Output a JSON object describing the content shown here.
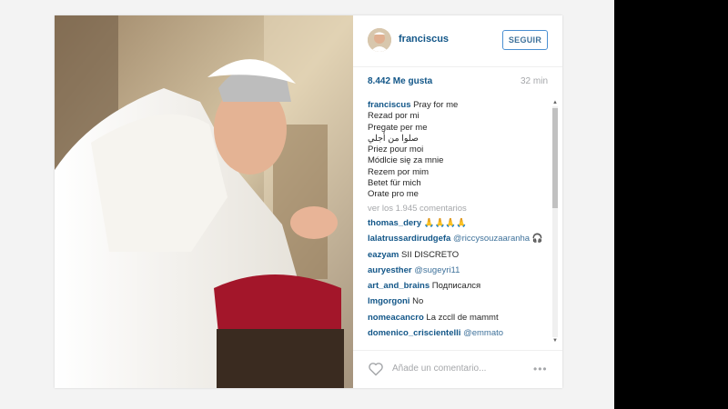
{
  "post": {
    "username": "franciscus",
    "follow_label": "SEGUIR",
    "likes": "8.442 Me gusta",
    "time": "32 min",
    "caption_user": "franciscus",
    "caption_lines": [
      "Pray for me",
      "Rezad por mi",
      "Pregate per me",
      "صلوا من أجلي",
      "Priez pour moi",
      "Módlcie się za mnie",
      "Rezem por mim",
      "Betet für mich",
      "Orate pro me"
    ],
    "view_all": "ver los 1.945 comentarios",
    "comments": [
      {
        "user": "thomas_dery",
        "text": " 🙏🙏🙏🙏"
      },
      {
        "user": "lalatrussardirudgefa",
        "mention": "@riccysouzaaranha",
        "text": " 🎧"
      },
      {
        "user": "eazyam",
        "text": "SII DISCRETO"
      },
      {
        "user": "auryesther",
        "mention": "@sugeyri11",
        "text": ""
      },
      {
        "user": "art_and_brains",
        "text": "Подписался"
      },
      {
        "user": "lmgorgoni",
        "text": "No"
      },
      {
        "user": "nomeacancro",
        "text": "La zccll de mammt"
      },
      {
        "user": "domenico_criscientelli",
        "text": "@emmato"
      }
    ],
    "add_comment_placeholder": "Añade un comentario...",
    "more_options": "•••"
  },
  "icons": {
    "heart": "heart-icon",
    "options": "more-options-icon",
    "scroll_up": "scroll-up-arrow",
    "scroll_down": "scroll-down-arrow"
  },
  "colors": {
    "link": "#125688",
    "follow_border": "#4b90d2",
    "muted": "#a5a7aa"
  }
}
